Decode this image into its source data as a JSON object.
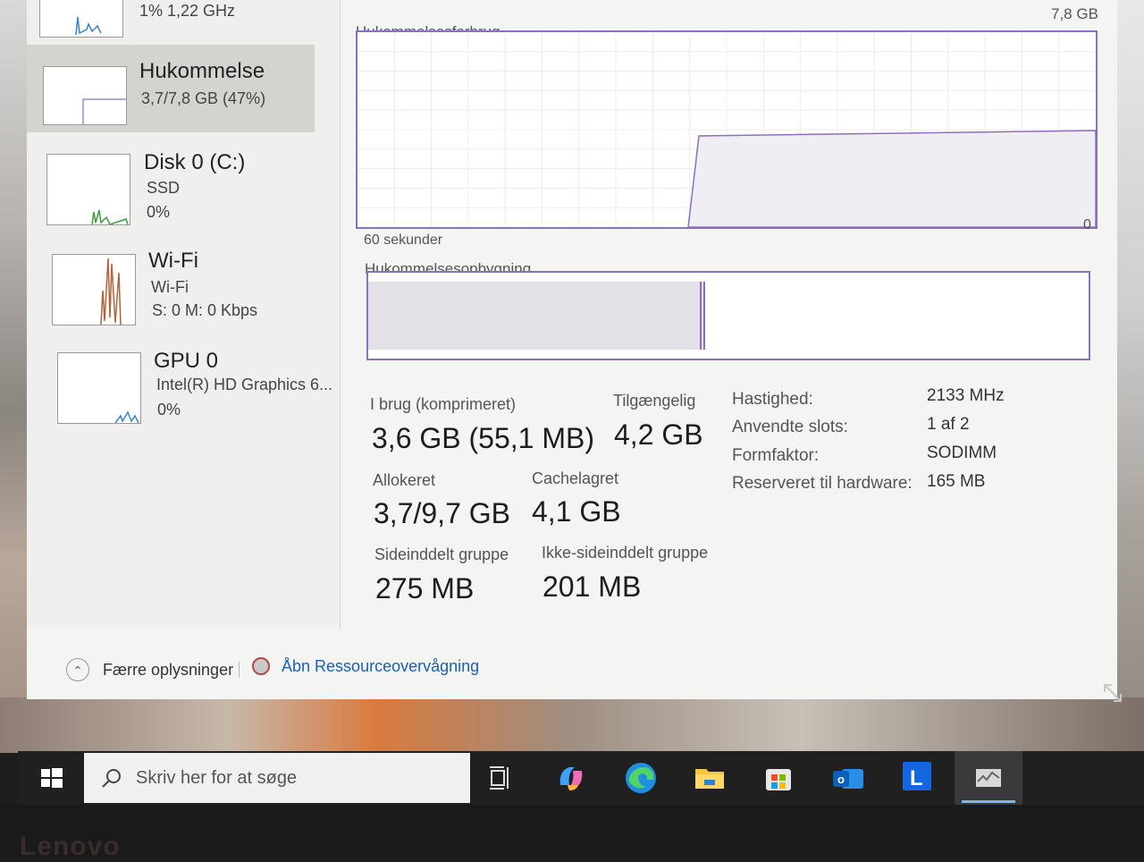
{
  "sidebar": {
    "cpu": {
      "stats": "1%  1,22 GHz"
    },
    "memory": {
      "title": "Hukommelse",
      "sub": "3,7/7,8 GB (47%)"
    },
    "disk": {
      "title": "Disk 0 (C:)",
      "type": "SSD",
      "usage": "0%"
    },
    "wifi": {
      "title": "Wi-Fi",
      "name": "Wi-Fi",
      "rate": "S: 0  M: 0 Kbps"
    },
    "gpu": {
      "title": "GPU 0",
      "name": "Intel(R) HD Graphics 6...",
      "usage": "0%"
    }
  },
  "detail": {
    "max_label": "7,8 GB",
    "usage_graph_label": "Hukommelsesforbrug",
    "axis_min": "0",
    "time_span": "60 sekunder",
    "composition_label": "Hukommelsesopbygning",
    "composition_in_use_fraction": 0.46,
    "stats": {
      "in_use_label": "I brug (komprimeret)",
      "in_use_value": "3,6 GB (55,1 MB)",
      "available_label": "Tilgængelig",
      "available_value": "4,2 GB",
      "committed_label": "Allokeret",
      "committed_value": "3,7/9,7 GB",
      "cached_label": "Cachelagret",
      "cached_value": "4,1 GB",
      "paged_label": "Sideinddelt gruppe",
      "paged_value": "275 MB",
      "nonpaged_label": "Ikke-sideinddelt gruppe",
      "nonpaged_value": "201 MB"
    },
    "props": [
      {
        "label": "Hastighed:",
        "value": "2133 MHz"
      },
      {
        "label": "Anvendte slots:",
        "value": "1 af 2"
      },
      {
        "label": "Formfaktor:",
        "value": "SODIMM"
      },
      {
        "label": "Reserveret til hardware:",
        "value": "165 MB"
      }
    ]
  },
  "footer": {
    "fewer_details": "Færre oplysninger",
    "open_resource_monitor": "Åbn Ressourceovervågning"
  },
  "taskbar": {
    "search_placeholder": "Skriv her for at søge",
    "icons": [
      "task-view",
      "copilot",
      "edge",
      "file-explorer",
      "microsoft-store",
      "outlook",
      "l-app",
      "task-manager"
    ]
  },
  "colors": {
    "accent": "#8d6fbf",
    "link": "#1a5fb4",
    "taskbar": "#202020"
  },
  "bezel": {
    "brand": "Lenovo"
  }
}
